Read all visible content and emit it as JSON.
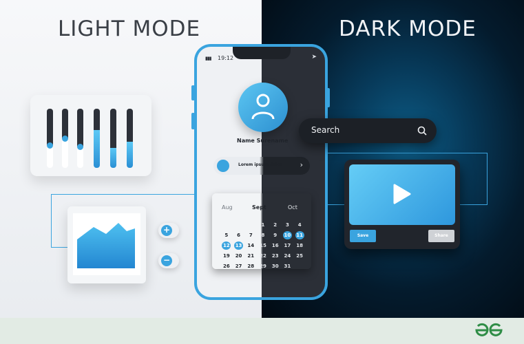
{
  "headings": {
    "light": "LIGHT MODE",
    "dark": "DARK MODE"
  },
  "phone": {
    "time": "19:12",
    "signal": "▮▮▮",
    "status_icon": "navigation-arrow",
    "name": "Name Surename",
    "lorem": "Lorem ipsum dolor",
    "calendar": {
      "months": [
        "Aug",
        "Sept",
        "Oct"
      ],
      "rows": [
        [
          "",
          "",
          "",
          "1",
          "2",
          "3",
          "4"
        ],
        [
          "5",
          "6",
          "7",
          "8",
          "9",
          "10",
          "11"
        ],
        [
          "12",
          "13",
          "14",
          "15",
          "16",
          "17",
          "18"
        ],
        [
          "19",
          "20",
          "21",
          "22",
          "23",
          "24",
          "25"
        ],
        [
          "26",
          "27",
          "28",
          "29",
          "30",
          "31",
          ""
        ]
      ],
      "selected": [
        "10",
        "11",
        "12",
        "13"
      ]
    }
  },
  "search": {
    "label": "Search",
    "icon": "search-icon"
  },
  "video": {
    "save": "Save",
    "share": "Share",
    "icon": "play-icon"
  },
  "sliders": [
    {
      "level": 0.62,
      "knob": true
    },
    {
      "level": 0.5,
      "knob": true
    },
    {
      "level": 0.64,
      "knob": true
    },
    {
      "level": 0.36,
      "knob": false
    },
    {
      "level": 0.66,
      "knob": false
    },
    {
      "level": 0.56,
      "knob": false
    }
  ],
  "zoom": {
    "plus": "+",
    "minus": "−"
  },
  "colors": {
    "accent": "#3aa4df",
    "dark": "#2b2f37",
    "light": "#eff1f4",
    "logo": "#2f8d46"
  }
}
